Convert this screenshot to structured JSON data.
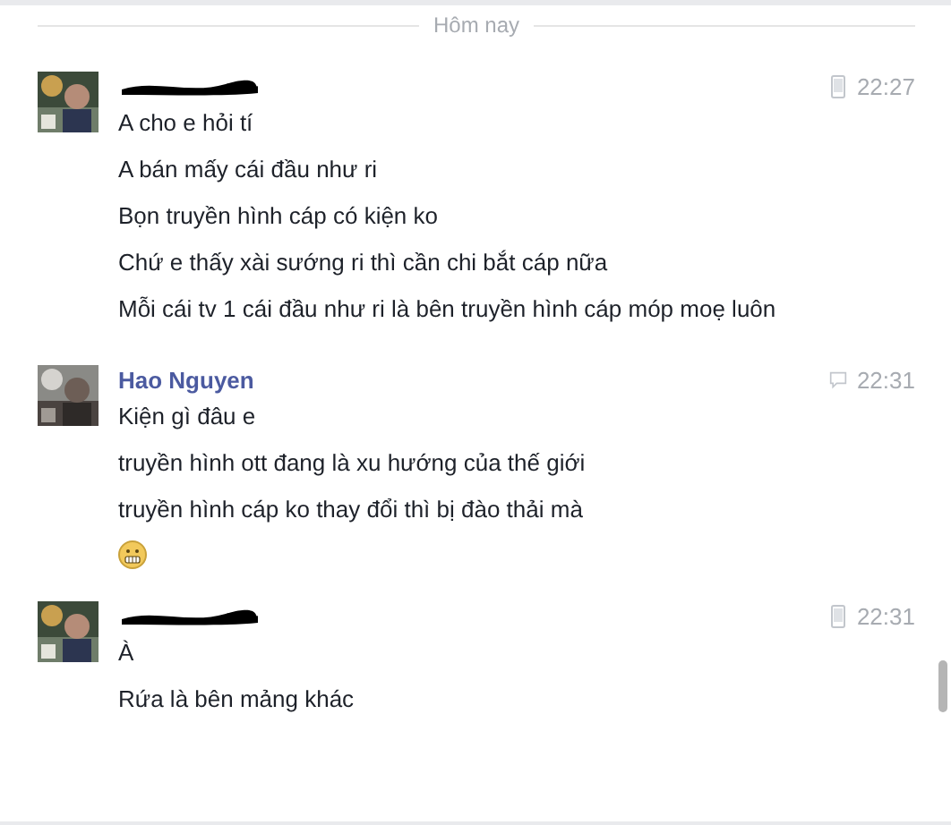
{
  "divider": {
    "label": "Hôm nay"
  },
  "groups": [
    {
      "redacted": true,
      "from_phone": true,
      "time": "22:27",
      "messages": [
        {
          "kind": "text",
          "text": "A cho e hỏi tí"
        },
        {
          "kind": "text",
          "text": "A bán mấy cái đầu như ri"
        },
        {
          "kind": "text",
          "text": "Bọn truyền hình cáp có kiện ko"
        },
        {
          "kind": "text",
          "text": "Chứ e thấy xài sướng ri thì cần chi bắt cáp nữa"
        },
        {
          "kind": "text",
          "text": "Mỗi cái tv 1 cái đầu như ri là bên truyền hình cáp móp moẹ luôn"
        }
      ]
    },
    {
      "redacted": false,
      "name": "Hao Nguyen",
      "from_phone": false,
      "time": "22:31",
      "messages": [
        {
          "kind": "text",
          "text": "Kiện gì đâu e"
        },
        {
          "kind": "text",
          "text": "truyền hình ott đang là xu hướng của thế giới"
        },
        {
          "kind": "text",
          "text": "truyền hình cáp ko thay đổi thì bị đào thải mà"
        },
        {
          "kind": "emoji"
        }
      ]
    },
    {
      "redacted": true,
      "from_phone": true,
      "time": "22:31",
      "messages": [
        {
          "kind": "text",
          "text": "À"
        },
        {
          "kind": "text",
          "text": "Rứa là bên mảng khác"
        }
      ]
    }
  ]
}
